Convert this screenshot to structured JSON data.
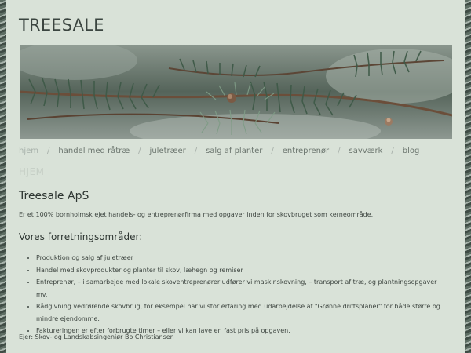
{
  "site": {
    "title": "TREESALE"
  },
  "banner": {
    "image": "fir-branch-photo"
  },
  "nav": {
    "items": [
      {
        "label": "hjem",
        "current": true
      },
      {
        "label": "handel med råtræ",
        "current": false
      },
      {
        "label": "juletræer",
        "current": false
      },
      {
        "label": "salg af planter",
        "current": false
      },
      {
        "label": "entreprenør",
        "current": false
      },
      {
        "label": "savværk",
        "current": false
      },
      {
        "label": "blog",
        "current": false
      }
    ],
    "separator": "/"
  },
  "main": {
    "ghost_heading": "HJEM",
    "company_title": "Treesale ApS",
    "intro": "Er et 100% bornholmsk ejet handels- og entreprenørfirma med opgaver inden for skovbruget som kerneområde.",
    "areas_title": "Vores forretningsområder:",
    "services": [
      "Produktion og salg af juletræer",
      "Handel med skovprodukter og planter til skov, læhegn og remiser",
      "Entreprenør, – i samarbejde med lokale skoventreprenører udfører vi maskinskovning, – transport af træ, og plantningsopgaver mv.",
      "Rådgivning vedrørende skovbrug,  for eksempel har vi stor erfaring med udarbejdelse af \"Grønne driftsplaner\" for både større og mindre ejendomme.",
      "Faktureringen er efter forbrugte timer – eller vi kan lave en fast pris på opgaven."
    ],
    "owner": "Ejer: Skov- og Landskabsingeniør Bo Christiansen"
  },
  "colors": {
    "page_background": "#d9e2d8",
    "text": "#3e4641",
    "nav_text": "#6c766f",
    "nav_current": "#a7b1aa",
    "ghost_heading": "#c6cfc6"
  }
}
